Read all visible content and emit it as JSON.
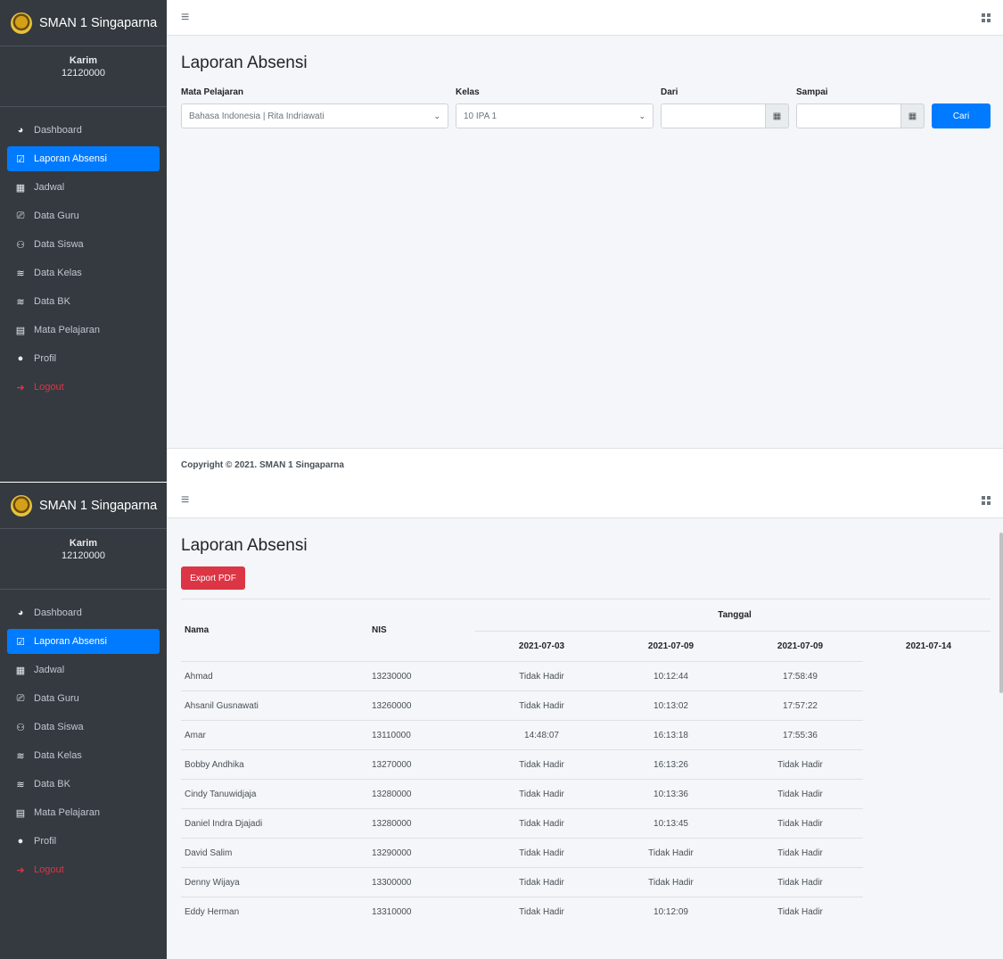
{
  "brand": {
    "name": "SMAN 1 Singaparna"
  },
  "user": {
    "name": "Karim",
    "nis": "12120000"
  },
  "nav": [
    {
      "label": "Dashboard",
      "icon": "tachometer-icon"
    },
    {
      "label": "Laporan Absensi",
      "icon": "check-square-icon",
      "active": true
    },
    {
      "label": "Jadwal",
      "icon": "calendar-icon"
    },
    {
      "label": "Data Guru",
      "icon": "chalkboard-teacher-icon"
    },
    {
      "label": "Data Siswa",
      "icon": "users-icon"
    },
    {
      "label": "Data Kelas",
      "icon": "layer-group-icon"
    },
    {
      "label": "Data BK",
      "icon": "layer-group-icon"
    },
    {
      "label": "Mata Pelajaran",
      "icon": "book-reader-icon"
    },
    {
      "label": "Profil",
      "icon": "user-icon"
    },
    {
      "label": "Logout",
      "icon": "sign-out-icon"
    }
  ],
  "page": {
    "title": "Laporan Absensi"
  },
  "filter": {
    "mapel_label": "Mata Pelajaran",
    "mapel_value": "Bahasa Indonesia | Rita Indriawati",
    "kelas_label": "Kelas",
    "kelas_value": "10 IPA 1",
    "dari_label": "Dari",
    "sampai_label": "Sampai",
    "cari_label": "Cari"
  },
  "footer": {
    "text": "Copyright © 2021. SMAN 1 Singaparna"
  },
  "report": {
    "export_label": "Export PDF",
    "col_nama": "Nama",
    "col_nis": "NIS",
    "col_tanggal": "Tanggal",
    "dates": [
      "2021-07-03",
      "2021-07-09",
      "2021-07-09",
      "2021-07-14"
    ],
    "rows": [
      {
        "nama": "Ahmad",
        "nis": "13230000",
        "d1": "Tidak Hadir",
        "d2": "10:12:44",
        "d3": "17:58:49"
      },
      {
        "nama": "Ahsanil Gusnawati",
        "nis": "13260000",
        "d1": "Tidak Hadir",
        "d2": "10:13:02",
        "d3": "17:57:22"
      },
      {
        "nama": "Amar",
        "nis": "13110000",
        "d1": "14:48:07",
        "d2": "16:13:18",
        "d3": "17:55:36"
      },
      {
        "nama": "Bobby Andhika",
        "nis": "13270000",
        "d1": "Tidak Hadir",
        "d2": "16:13:26",
        "d3": "Tidak Hadir"
      },
      {
        "nama": "Cindy Tanuwidjaja",
        "nis": "13280000",
        "d1": "Tidak Hadir",
        "d2": "10:13:36",
        "d3": "Tidak Hadir"
      },
      {
        "nama": "Daniel Indra Djajadi",
        "nis": "13280000",
        "d1": "Tidak Hadir",
        "d2": "10:13:45",
        "d3": "Tidak Hadir"
      },
      {
        "nama": "David Salim",
        "nis": "13290000",
        "d1": "Tidak Hadir",
        "d2": "Tidak Hadir",
        "d3": "Tidak Hadir"
      },
      {
        "nama": "Denny Wijaya",
        "nis": "13300000",
        "d1": "Tidak Hadir",
        "d2": "Tidak Hadir",
        "d3": "Tidak Hadir"
      },
      {
        "nama": "Eddy Herman",
        "nis": "13310000",
        "d1": "Tidak Hadir",
        "d2": "10:12:09",
        "d3": "Tidak Hadir"
      }
    ]
  },
  "colors": {
    "sidebar": "#343a40",
    "primary": "#007bff",
    "danger": "#dc3545",
    "content_bg": "#f4f6f9"
  }
}
